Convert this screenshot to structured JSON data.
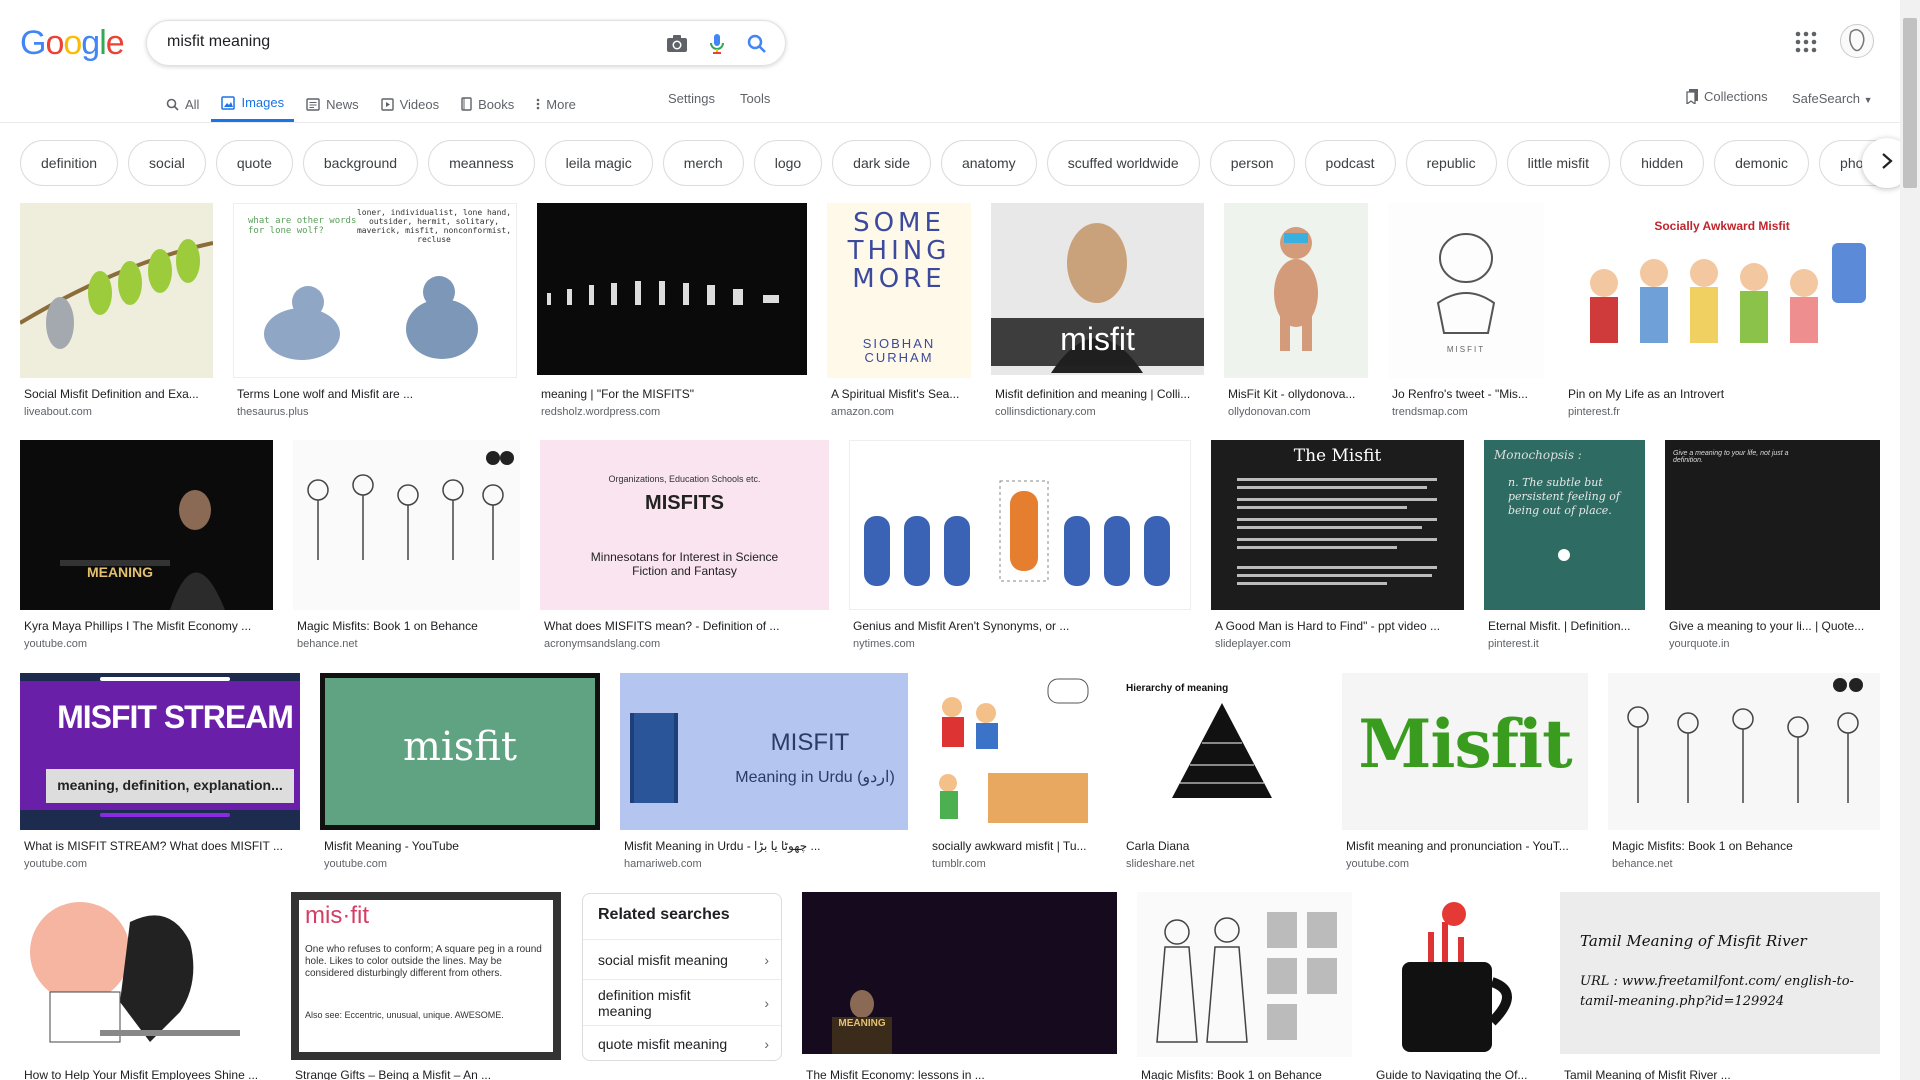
{
  "logo": {
    "letters": [
      "G",
      "o",
      "o",
      "g",
      "l",
      "e"
    ],
    "colors": [
      "#4285f4",
      "#ea4335",
      "#fbbc05",
      "#4285f4",
      "#34a853",
      "#ea4335"
    ]
  },
  "search": {
    "query": "misfit meaning"
  },
  "tabs": [
    {
      "label": "All",
      "icon": "search-icon"
    },
    {
      "label": "Images",
      "icon": "image-icon"
    },
    {
      "label": "News",
      "icon": "news-icon"
    },
    {
      "label": "Videos",
      "icon": "video-icon"
    },
    {
      "label": "Books",
      "icon": "book-icon"
    },
    {
      "label": "More",
      "icon": "more-vert-icon"
    }
  ],
  "toolbar": {
    "settings": "Settings",
    "tools": "Tools",
    "collections": "Collections",
    "safesearch": "SafeSearch"
  },
  "chips": [
    "definition",
    "social",
    "quote",
    "background",
    "meanness",
    "leila magic",
    "merch",
    "logo",
    "dark side",
    "anatomy",
    "scuffed worldwide",
    "person",
    "podcast",
    "republic",
    "little misfit",
    "hidden",
    "demonic",
    "phone"
  ],
  "results": [
    {
      "caption": "Social Misfit Definition and Exa...",
      "source": "liveabout.com"
    },
    {
      "caption": "Terms Lone wolf and Misfit are ...",
      "source": "thesaurus.plus",
      "thumb_text": "what are other words for lone wolf?",
      "thumb_text2": "loner, individualist, lone hand, outsider, hermit, solitary, maverick, misfit, nonconformist, recluse"
    },
    {
      "caption": "meaning | \"For the MISFITS\"",
      "source": "redsholz.wordpress.com"
    },
    {
      "caption": "A Spiritual Misfit's Sea...",
      "source": "amazon.com",
      "thumb_text": "SOME THING MORE",
      "thumb_text2": "SIOBHAN CURHAM"
    },
    {
      "caption": "Misfit definition and meaning | Colli...",
      "source": "collinsdictionary.com",
      "thumb_text": "misfit"
    },
    {
      "caption": "MisFit Kit - ollydonova...",
      "source": "ollydonovan.com"
    },
    {
      "caption": "Jo Renfro's tweet - \"Mis...",
      "source": "trendsmap.com",
      "thumb_text": "MISFIT"
    },
    {
      "caption": "Pin on My Life as an Introvert",
      "source": "pinterest.fr",
      "thumb_text": "Socially Awkward Misfit"
    },
    {
      "caption": "Kyra Maya Phillips I The Misfit Economy ...",
      "source": "youtube.com",
      "thumb_text": "MEANING"
    },
    {
      "caption": "Magic Misfits: Book 1 on Behance",
      "source": "behance.net"
    },
    {
      "caption": "What does MISFITS mean? - Definition of ...",
      "source": "acronymsandslang.com",
      "thumb_text": "MISFITS",
      "thumb_text2": "Minnesotans for Interest in Science Fiction and Fantasy",
      "thumb_text3": "Organizations, Education Schools etc."
    },
    {
      "caption": "Genius and Misfit Aren't Synonyms, or ...",
      "source": "nytimes.com"
    },
    {
      "caption": "A Good Man is Hard to Find\" - ppt video ...",
      "source": "slideplayer.com",
      "thumb_text": "The Misfit"
    },
    {
      "caption": "Eternal Misfit. | Definition...",
      "source": "pinterest.it",
      "thumb_text": "Monochopsis :",
      "thumb_text2": "n. The subtle but persistent feeling of being out of place."
    },
    {
      "caption": "Give a meaning to your li... | Quote...",
      "source": "yourquote.in",
      "thumb_text": "Give a meaning to your life, not just a definition."
    },
    {
      "caption": "What is MISFIT STREAM? What does MISFIT ...",
      "source": "youtube.com",
      "thumb_text": "MISFIT STREAM",
      "thumb_text2": "meaning, definition, explanation..."
    },
    {
      "caption": "Misfit Meaning - YouTube",
      "source": "youtube.com",
      "thumb_text": "misfit"
    },
    {
      "caption": "Misfit Meaning in Urdu - چھوٹا یا بڑا ...",
      "source": "hamariweb.com",
      "thumb_text": "MISFIT",
      "thumb_text2": "Meaning in Urdu (اردو)"
    },
    {
      "caption": "socially awkward misfit | Tu...",
      "source": "tumblr.com"
    },
    {
      "caption": "Carla Diana",
      "source": "slideshare.net",
      "thumb_text": "Hierarchy of meaning"
    },
    {
      "caption": "Misfit meaning and pronunciation - YouT...",
      "source": "youtube.com",
      "thumb_text": "Misfit"
    },
    {
      "caption": "Magic Misfits: Book 1 on Behance",
      "source": "behance.net"
    },
    {
      "caption": "How to Help Your Misfit Employees Shine ...",
      "source": ""
    },
    {
      "caption": "Strange Gifts – Being a Misfit – An ...",
      "source": "",
      "thumb_text": "mis·fit",
      "thumb_text2": "One who refuses to conform; A square peg in a round hole. Likes to color outside the lines. May be considered disturbingly different from others.",
      "thumb_text3": "Also see: Eccentric, unusual, unique. AWESOME."
    },
    {
      "caption": "The Misfit Economy: lessons in ...",
      "source": "",
      "thumb_text": "MEANING"
    },
    {
      "caption": "Magic Misfits: Book 1 on Behance",
      "source": ""
    },
    {
      "caption": "Guide to Navigating the Of...",
      "source": ""
    },
    {
      "caption": "Tamil Meaning of Misfit River ...",
      "source": "",
      "thumb_text": "Tamil Meaning of Misfit River",
      "thumb_text2": "URL : www.freetamilfont.com/ english-to-tamil-meaning.php?id=129924"
    }
  ],
  "related": {
    "title": "Related searches",
    "items": [
      "social misfit meaning",
      "definition misfit meaning",
      "quote misfit meaning"
    ]
  }
}
